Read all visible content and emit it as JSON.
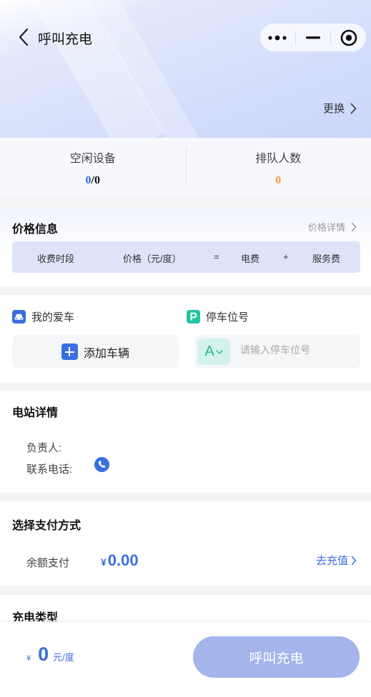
{
  "header": {
    "title": "呼叫充电",
    "change_label": "更换"
  },
  "stats": {
    "idle_label": "空闲设备",
    "idle_available": "0",
    "idle_separator": "/",
    "idle_total": "0",
    "queue_label": "排队人数",
    "queue_count": "0"
  },
  "price": {
    "title": "价格信息",
    "detail_link": "价格详情",
    "columns": [
      "收费时段",
      "价格（元/度）",
      "=",
      "电费",
      "+",
      "服务费"
    ]
  },
  "car": {
    "my_car_label": "我的爱车",
    "add_car_label": "添加车辆",
    "parking_label": "停车位号",
    "parking_prefix": "A",
    "parking_placeholder": "请输入停车位号",
    "parking_value": ""
  },
  "station": {
    "title": "电站详情",
    "manager_label": "负责人:",
    "phone_label": "联系电话:"
  },
  "payment": {
    "title": "选择支付方式",
    "method_label": "余额支付",
    "currency": "¥",
    "balance": "0.00",
    "recharge_label": "去充值"
  },
  "charge_type": {
    "title": "充电类型"
  },
  "bottom": {
    "currency": "¥",
    "price": "0",
    "unit": "元/度",
    "call_button": "呼叫充电"
  },
  "colors": {
    "accent": "#3a6ee0",
    "button_disabled": "#a4b5ec",
    "queue_orange": "#f39a3c",
    "parking_green": "#23b89a"
  }
}
